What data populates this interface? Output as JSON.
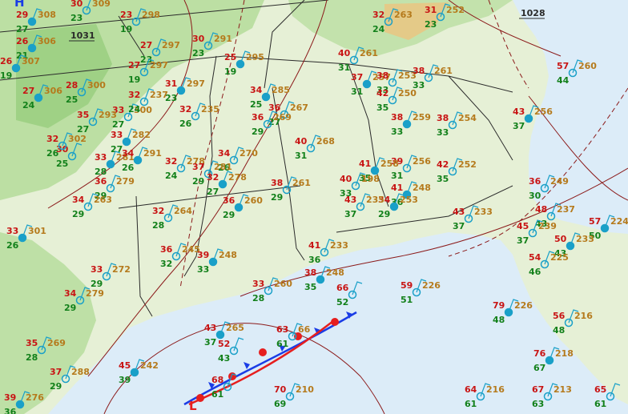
{
  "map": {
    "pressure_centers": [
      {
        "symbol": "H",
        "value": "1031"
      },
      {
        "symbol": "L",
        "value": ""
      },
      {
        "symbol": "",
        "value": "1028"
      }
    ],
    "colors": {
      "land": "#e6f0d6",
      "water": "#dcecf8",
      "precip_light": "#b4dc9a",
      "precip_mid": "#7cc062",
      "temperature": "#c81414",
      "dewpoint": "#12801a",
      "pressure": "#b57a1c",
      "station": "#1aa0c8",
      "cold_front": "#1a3ce6",
      "warm_front": "#e61e1e",
      "isobar": "#8b1a1a"
    },
    "stations": [
      {
        "t": "29",
        "d": "27",
        "p": "308"
      },
      {
        "t": "30",
        "d": "23",
        "p": "309"
      },
      {
        "t": "23",
        "d": "19",
        "p": "298"
      },
      {
        "t": "26",
        "d": "21",
        "p": "306"
      },
      {
        "t": "27",
        "d": "23",
        "p": "297"
      },
      {
        "t": "30",
        "d": "23",
        "p": "291"
      },
      {
        "t": "25",
        "d": "19",
        "p": "295"
      },
      {
        "t": "32",
        "d": "24",
        "p": "263"
      },
      {
        "t": "31",
        "d": "23",
        "p": "252"
      },
      {
        "t": "26",
        "d": "19",
        "p": "307"
      },
      {
        "t": "28",
        "d": "25",
        "p": "300"
      },
      {
        "t": "27",
        "d": "19",
        "p": "297"
      },
      {
        "t": "31",
        "d": "23",
        "p": "297"
      },
      {
        "t": "30",
        "d": "25",
        "p": ""
      },
      {
        "t": "40",
        "d": "31",
        "p": "261"
      },
      {
        "t": "37",
        "d": "31",
        "p": "257"
      },
      {
        "t": "38",
        "d": "33",
        "p": "253"
      },
      {
        "t": "38",
        "d": "33",
        "p": "261"
      },
      {
        "t": "27",
        "d": "24",
        "p": "306"
      },
      {
        "t": "33",
        "d": "27",
        "p": "300"
      },
      {
        "t": "32",
        "d": "24",
        "p": "237"
      },
      {
        "t": "34",
        "d": "25",
        "p": "285"
      },
      {
        "t": "36",
        "d": "27",
        "p": "267"
      },
      {
        "t": "42",
        "d": "35",
        "p": "250"
      },
      {
        "t": "43",
        "d": "37",
        "p": "256"
      },
      {
        "t": "57",
        "d": "44",
        "p": "260"
      },
      {
        "t": "35",
        "d": "27",
        "p": "293"
      },
      {
        "t": "33",
        "d": "27",
        "p": "282"
      },
      {
        "t": "32",
        "d": "26",
        "p": "235"
      },
      {
        "t": "36",
        "d": "29",
        "p": "269"
      },
      {
        "t": "38",
        "d": "33",
        "p": "259"
      },
      {
        "t": "38",
        "d": "33",
        "p": "254"
      },
      {
        "t": "32",
        "d": "26",
        "p": "302"
      },
      {
        "t": "33",
        "d": "28",
        "p": "281"
      },
      {
        "t": "40",
        "d": "31",
        "p": "268"
      },
      {
        "t": "39",
        "d": "31",
        "p": "256"
      },
      {
        "t": "34",
        "d": "26",
        "p": "291"
      },
      {
        "t": "32",
        "d": "24",
        "p": "278"
      },
      {
        "t": "34",
        "d": "26",
        "p": "270"
      },
      {
        "t": "41",
        "d": "35",
        "p": "258"
      },
      {
        "t": "42",
        "d": "35",
        "p": "252"
      },
      {
        "t": "37",
        "d": "29",
        "p": "281"
      },
      {
        "t": "32",
        "d": "27",
        "p": "278"
      },
      {
        "t": "38",
        "d": "29",
        "p": "261"
      },
      {
        "t": "40",
        "d": "33",
        "p": "198"
      },
      {
        "t": "41",
        "d": "36",
        "p": "248"
      },
      {
        "t": "36",
        "d": "29",
        "p": "279"
      },
      {
        "t": "36",
        "d": "30",
        "p": "249"
      },
      {
        "t": "34",
        "d": "29",
        "p": "253"
      },
      {
        "t": "43",
        "d": "37",
        "p": "235"
      },
      {
        "t": "48",
        "d": "43",
        "p": "237"
      },
      {
        "t": "57",
        "d": "50",
        "p": "224"
      },
      {
        "t": "34",
        "d": "29",
        "p": "263"
      },
      {
        "t": "32",
        "d": "28",
        "p": "264"
      },
      {
        "t": "36",
        "d": "29",
        "p": "260"
      },
      {
        "t": "43",
        "d": "37",
        "p": "233"
      },
      {
        "t": "45",
        "d": "37",
        "p": "239"
      },
      {
        "t": "50",
        "d": "43",
        "p": "233"
      },
      {
        "t": "33",
        "d": "29",
        "p": "272"
      },
      {
        "t": "36",
        "d": "32",
        "p": "245"
      },
      {
        "t": "39",
        "d": "33",
        "p": "248"
      },
      {
        "t": "41",
        "d": "36",
        "p": "233"
      },
      {
        "t": "54",
        "d": "46",
        "p": "225"
      },
      {
        "t": "33",
        "d": "26",
        "p": "301"
      },
      {
        "t": "34",
        "d": "29",
        "p": "279"
      },
      {
        "t": "33",
        "d": "28",
        "p": "260"
      },
      {
        "t": "38",
        "d": "35",
        "p": "248"
      },
      {
        "t": "59",
        "d": "51",
        "p": "226"
      },
      {
        "t": "66",
        "d": "52",
        "p": ""
      },
      {
        "t": "79",
        "d": "48",
        "p": "226"
      },
      {
        "t": "56",
        "d": "48",
        "p": "216"
      },
      {
        "t": "35",
        "d": "28",
        "p": "269"
      },
      {
        "t": "43",
        "d": "37",
        "p": "265"
      },
      {
        "t": "52",
        "d": "43",
        "p": ""
      },
      {
        "t": "63",
        "d": "61",
        "p": "66"
      },
      {
        "t": "76",
        "d": "67",
        "p": "218"
      },
      {
        "t": "67",
        "d": "63",
        "p": "213"
      },
      {
        "t": "37",
        "d": "29",
        "p": "288"
      },
      {
        "t": "45",
        "d": "39",
        "p": "242"
      },
      {
        "t": "68",
        "d": "61",
        "p": ""
      },
      {
        "t": "70",
        "d": "69",
        "p": "210"
      },
      {
        "t": "39",
        "d": "36",
        "p": "276"
      },
      {
        "t": "65",
        "d": "61",
        "p": ""
      },
      {
        "t": "64",
        "d": "61",
        "p": "216"
      }
    ]
  }
}
